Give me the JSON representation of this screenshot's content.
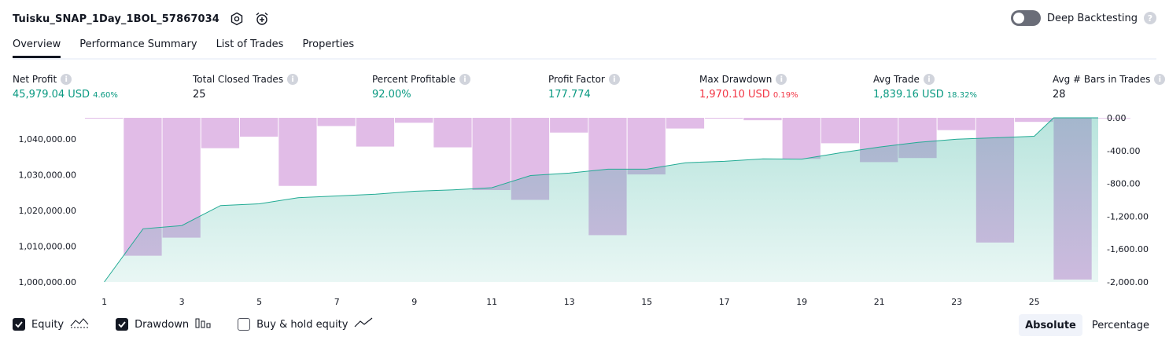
{
  "header": {
    "title": "Tuisku_SNAP_1Day_1BOL_57867034",
    "settings_icon": "hexagon-gear-icon",
    "alert_icon": "alarm-add-icon"
  },
  "deep_backtesting": {
    "label": "Deep Backtesting",
    "enabled": false
  },
  "tabs": [
    "Overview",
    "Performance Summary",
    "List of Trades",
    "Properties"
  ],
  "metrics": [
    {
      "label": "Net Profit",
      "value": "45,979.04 USD",
      "sub": "4.60%",
      "color": "green"
    },
    {
      "label": "Total Closed Trades",
      "value": "25",
      "sub": "",
      "color": ""
    },
    {
      "label": "Percent Profitable",
      "value": "92.00%",
      "sub": "",
      "color": "green"
    },
    {
      "label": "Profit Factor",
      "value": "177.774",
      "sub": "",
      "color": "green"
    },
    {
      "label": "Max Drawdown",
      "value": "1,970.10 USD",
      "sub": "0.19%",
      "color": "red"
    },
    {
      "label": "Avg Trade",
      "value": "1,839.16 USD",
      "sub": "18.32%",
      "color": "green"
    },
    {
      "label": "Avg # Bars in Trades",
      "value": "28",
      "sub": "",
      "color": ""
    }
  ],
  "chart_data": {
    "type": "area",
    "left_axis": {
      "ticks": [
        "1,040,000.00",
        "1,030,000.00",
        "1,020,000.00",
        "1,010,000.00",
        "1,000,000.00"
      ],
      "range": [
        1000000,
        1045979
      ]
    },
    "right_axis": {
      "ticks": [
        "0.00",
        "-400.00",
        "-800.00",
        "-1,200.00",
        "-1,600.00",
        "-2,000.00"
      ],
      "range": [
        -2000,
        0
      ]
    },
    "x_ticks": [
      "1",
      "3",
      "5",
      "7",
      "9",
      "11",
      "13",
      "15",
      "17",
      "19",
      "21",
      "23",
      "25"
    ],
    "series": [
      {
        "name": "Equity",
        "color": "#22ab94",
        "x": [
          1,
          2,
          3,
          4,
          5,
          6,
          7,
          8,
          9,
          10,
          11,
          12,
          13,
          14,
          15,
          16,
          17,
          18,
          19,
          20,
          21,
          22,
          23,
          24,
          25,
          26,
          27
        ],
        "values": [
          1000000,
          1014900,
          1015800,
          1021400,
          1021900,
          1023600,
          1024100,
          1024600,
          1025400,
          1025800,
          1026400,
          1029800,
          1030500,
          1031600,
          1031600,
          1033400,
          1033800,
          1034500,
          1034400,
          1036200,
          1037800,
          1039100,
          1040000,
          1040400,
          1040800,
          1045979,
          1045979
        ]
      },
      {
        "name": "Drawdown",
        "color": "#ce93d8",
        "x": [
          1,
          2,
          3,
          4,
          5,
          6,
          7,
          8,
          9,
          10,
          11,
          12,
          13,
          14,
          15,
          16,
          17,
          18,
          19,
          20,
          21,
          22,
          23,
          24,
          25,
          26,
          27
        ],
        "values": [
          -10,
          -1680,
          -1460,
          -370,
          -230,
          -830,
          -100,
          -350,
          -60,
          -360,
          -880,
          -1000,
          -180,
          -1430,
          -690,
          -130,
          -10,
          -30,
          -500,
          -310,
          -540,
          -490,
          -150,
          -1520,
          -50,
          -1970,
          0
        ]
      }
    ]
  },
  "legend": {
    "items": [
      {
        "label": "Equity",
        "checked": true,
        "icon": "equity-line-icon"
      },
      {
        "label": "Drawdown",
        "checked": true,
        "icon": "drawdown-bars-icon"
      },
      {
        "label": "Buy & hold equity",
        "checked": false,
        "icon": "buy-hold-line-icon"
      }
    ]
  },
  "view_modes": {
    "options": [
      "Absolute",
      "Percentage"
    ],
    "selected": "Absolute"
  }
}
